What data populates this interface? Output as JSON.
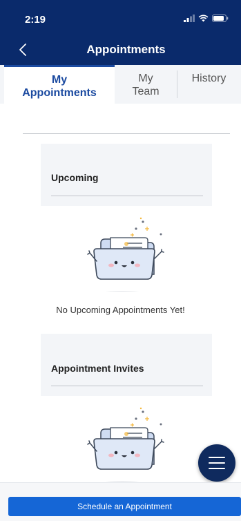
{
  "status": {
    "time": "2:19"
  },
  "header": {
    "title": "Appointments"
  },
  "tabs": [
    {
      "line1": "My",
      "line2": "Appointments"
    },
    {
      "line1": "My",
      "line2": "Team"
    },
    {
      "line1": "History",
      "line2": ""
    }
  ],
  "sections": {
    "upcoming": {
      "title": "Upcoming",
      "empty_text": "No Upcoming Appointments Yet!"
    },
    "invites": {
      "title": "Appointment Invites"
    }
  },
  "footer": {
    "schedule_label": "Schedule an Appointment"
  },
  "colors": {
    "header_bg": "#0a2a6b",
    "accent": "#1b4aa0",
    "button": "#1566d6",
    "fab": "#0f2a5e"
  }
}
